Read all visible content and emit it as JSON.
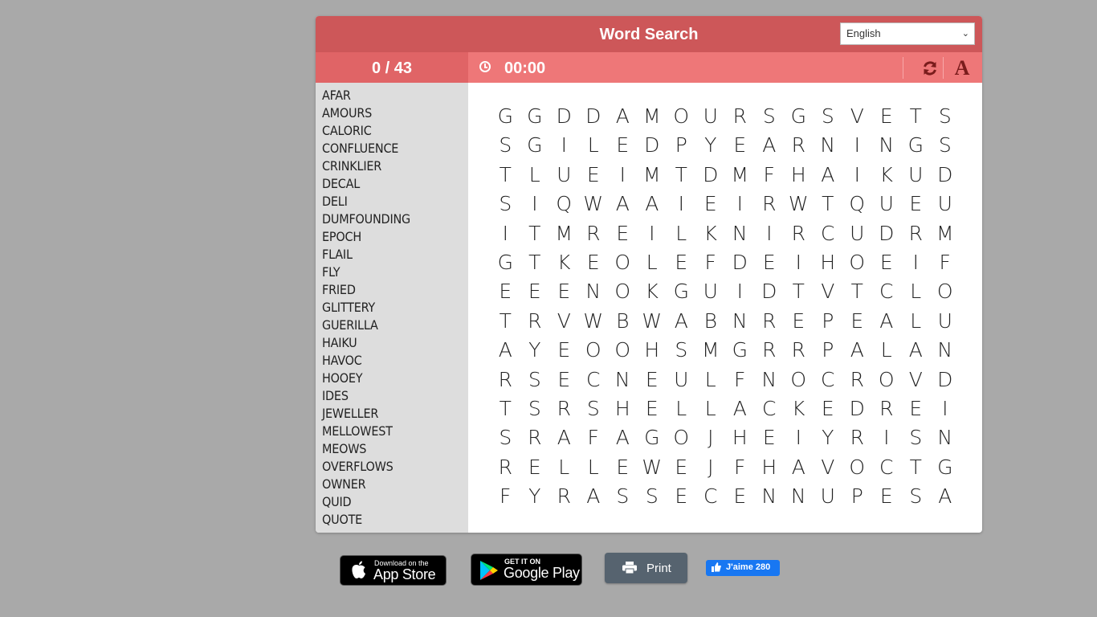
{
  "header": {
    "title": "Word Search",
    "language_selected": "English"
  },
  "status": {
    "found": 0,
    "total": 43,
    "counter_text": "0 / 43",
    "timer": "00:00"
  },
  "toolbar": {
    "refresh_icon": "↻",
    "font_icon": "A"
  },
  "words": [
    "AFAR",
    "AMOURS",
    "CALORIC",
    "CONFLUENCE",
    "CRINKLIER",
    "DECAL",
    "DELI",
    "DUMFOUNDING",
    "EPOCH",
    "FLAIL",
    "FLY",
    "FRIED",
    "GLITTERY",
    "GUERILLA",
    "HAIKU",
    "HAVOC",
    "HOOEY",
    "IDES",
    "JEWELLER",
    "MELLOWEST",
    "MEOWS",
    "OVERFLOWS",
    "OWNER",
    "QUID",
    "QUOTE"
  ],
  "grid": [
    "GGDDAMOURSGSVETS",
    "SGILEDPYEARNINGS",
    "TLUEIMTDMFHAIKUD",
    "SIQWAAIEIRWTQUEU",
    "ITMREILKNIRCUDRM",
    "GTKEOLEFDEIHOEIF",
    "EEENOKGUIDTVTCLO",
    "TRVWBWABNREPEALU",
    "AYEOOHSMGRRPALAN",
    "RSECNEULFNOCROVD",
    "TSRSHELLACKEDREI",
    "SRAFAGOJHEIYRISN",
    "RELLEWEJFHAVOCTG",
    "FYRASSECENNUPESA"
  ],
  "footer": {
    "appstore_small": "Download on the",
    "appstore_big": "App Store",
    "apple_icon": "",
    "gplay_small": "GET IT ON",
    "gplay_big": "Google Play",
    "print_label": "Print",
    "like_label": "J'aime 280",
    "like_icon": "👍"
  }
}
